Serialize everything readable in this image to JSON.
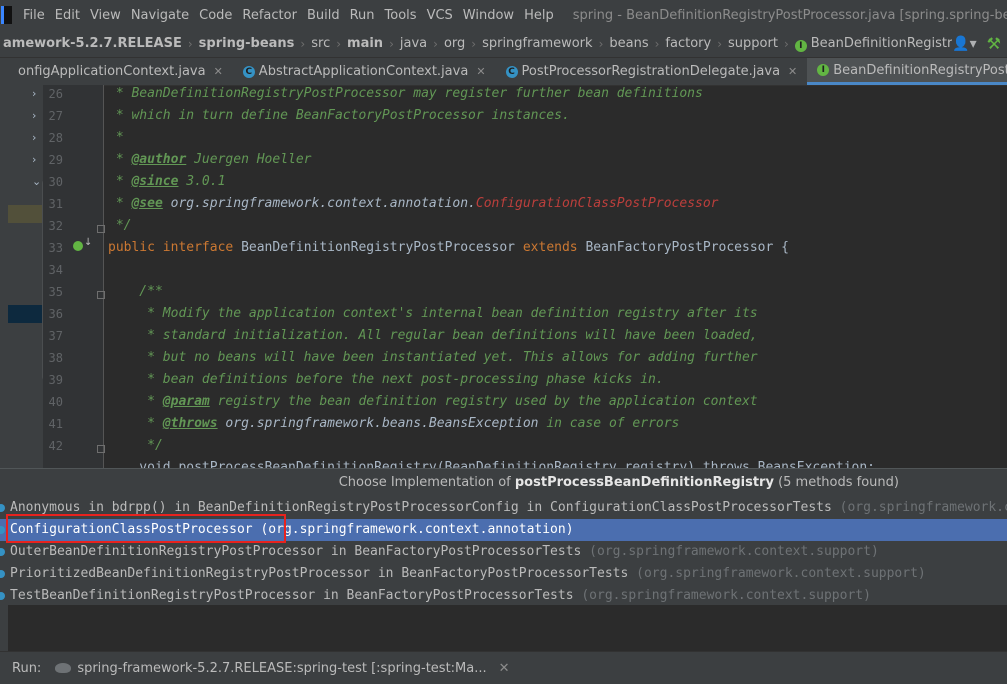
{
  "menu": {
    "items": [
      "File",
      "Edit",
      "View",
      "Navigate",
      "Code",
      "Refactor",
      "Build",
      "Run",
      "Tools",
      "VCS",
      "Window",
      "Help"
    ],
    "window_title": "spring - BeanDefinitionRegistryPostProcessor.java [spring.spring-beans.main]"
  },
  "breadcrumb": {
    "items": [
      "amework-5.2.7.RELEASE",
      "spring-beans",
      "src",
      "main",
      "java",
      "org",
      "springframework",
      "beans",
      "factory",
      "support"
    ],
    "current": "BeanDefinitionRegistryPostProcessor"
  },
  "tabs": [
    {
      "label": "onfigApplicationContext.java"
    },
    {
      "label": "AbstractApplicationContext.java"
    },
    {
      "label": "PostProcessorRegistrationDelegate.java"
    },
    {
      "label": "BeanDefinitionRegistryPostProcessor.java"
    }
  ],
  "editor": {
    "line_numbers": [
      "26",
      "27",
      "28",
      "29",
      "30",
      "31",
      "32",
      "33",
      "34",
      "35",
      "36",
      "37",
      "38",
      "39",
      "40",
      "41",
      "42"
    ],
    "lines": {
      "l26": " * BeanDefinitionRegistryPostProcessor may register further bean definitions",
      "l27": " * which in turn define BeanFactoryPostProcessor instances.",
      "l28": " *",
      "l29a": " * ",
      "l29tag": "@author",
      "l29b": " Juergen Hoeller",
      "l30a": " * ",
      "l30tag": "@since",
      "l30b": " 3.0.1",
      "l31a": " * ",
      "l31tag": "@see",
      "l31b": " org.springframework.context.annotation.",
      "l31c": "ConfigurationClassPostProcessor",
      "l32": " */",
      "l33kw1": "public",
      "l33kw2": "interface",
      "l33name": "BeanDefinitionRegistryPostProcessor",
      "l33kw3": "extends",
      "l33rest": "BeanFactoryPostProcessor {",
      "l35": "    /**",
      "l36": "     * Modify the application context's internal bean definition registry after its",
      "l37": "     * standard initialization. All regular bean definitions will have been loaded,",
      "l38": "     * but no beans will have been instantiated yet. This allows for adding further",
      "l39": "     * bean definitions before the next post-processing phase kicks in.",
      "l40a": "     * ",
      "l40tag": "@param",
      "l40b": " registry the bean definition registry used by the application context",
      "l41a": "     * ",
      "l41tag": "@throws",
      "l41ref": " org.springframework.beans.BeansException",
      "l41b": " in case of errors",
      "l42": "     */",
      "l43": "    void postProcessBeanDefinitionRegistry(BeanDefinitionRegistry registry) throws BeansException;"
    }
  },
  "popup": {
    "title_prefix": "Choose Implementation of ",
    "title_method": "postProcessBeanDefinitionRegistry",
    "title_suffix": " (5 methods found)",
    "items": [
      {
        "name": "Anonymous in bdrpp() in BeanDefinitionRegistryPostProcessorConfig in ConfigurationClassPostProcessorTests",
        "pkg": " (org.springframework.context.annotation)"
      },
      {
        "name": "ConfigurationClassPostProcessor",
        "pkg": " (org.springframework.context.annotation)"
      },
      {
        "name": "OuterBeanDefinitionRegistryPostProcessor in BeanFactoryPostProcessorTests",
        "pkg": " (org.springframework.context.support)"
      },
      {
        "name": "PrioritizedBeanDefinitionRegistryPostProcessor in BeanFactoryPostProcessorTests",
        "pkg": " (org.springframework.context.support)"
      },
      {
        "name": "TestBeanDefinitionRegistryPostProcessor in BeanFactoryPostProcessorTests",
        "pkg": " (org.springframework.context.support)"
      }
    ],
    "selected_index": 1
  },
  "status": {
    "run_label": "Run:",
    "run_config": "spring-framework-5.2.7.RELEASE:spring-test [:spring-test:Ma..."
  },
  "colors": {
    "background": "#2b2b2b",
    "selection": "#4b6eaf",
    "highlight_box": "#e8221e",
    "doc_comment": "#629755",
    "keyword": "#cc7832"
  }
}
